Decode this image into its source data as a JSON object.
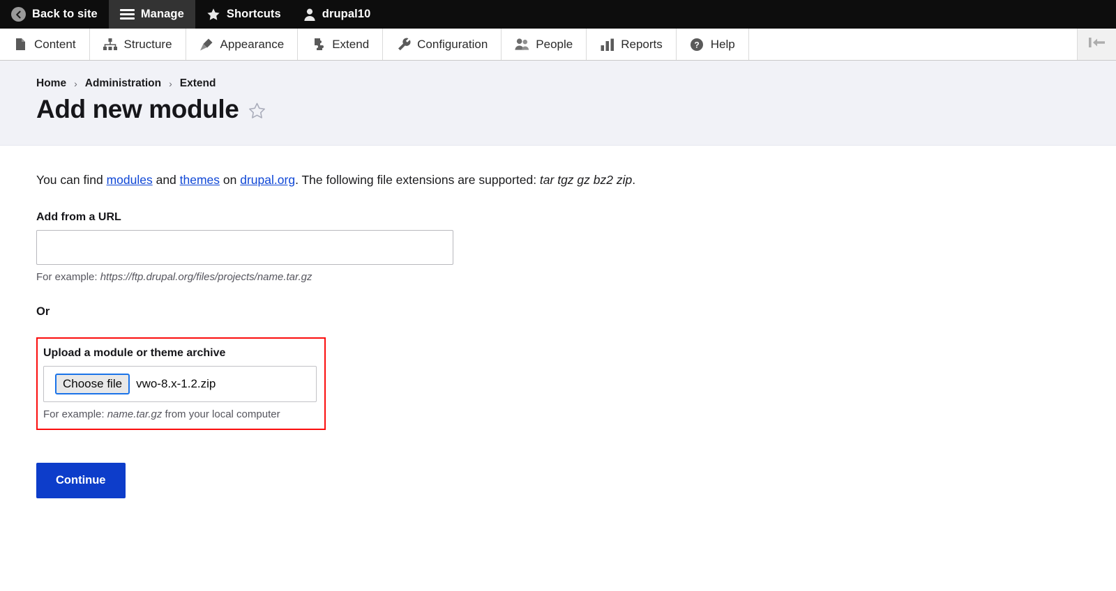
{
  "toolbar_top": {
    "items": [
      {
        "label": "Back to site",
        "icon": "back-circle-icon",
        "active": false
      },
      {
        "label": "Manage",
        "icon": "hamburger-icon",
        "active": true
      },
      {
        "label": "Shortcuts",
        "icon": "star-icon",
        "active": false
      },
      {
        "label": "drupal10",
        "icon": "user-icon",
        "active": false
      }
    ]
  },
  "admin_menu": {
    "items": [
      {
        "label": "Content",
        "icon": "document-icon"
      },
      {
        "label": "Structure",
        "icon": "sitemap-icon"
      },
      {
        "label": "Appearance",
        "icon": "paintbrush-icon"
      },
      {
        "label": "Extend",
        "icon": "puzzle-piece-icon"
      },
      {
        "label": "Configuration",
        "icon": "wrench-icon"
      },
      {
        "label": "People",
        "icon": "people-icon"
      },
      {
        "label": "Reports",
        "icon": "bar-chart-icon"
      },
      {
        "label": "Help",
        "icon": "question-mark-icon"
      }
    ],
    "orientation_toggle_icon": "toolbar-orientation-icon"
  },
  "header": {
    "breadcrumb": [
      "Home",
      "Administration",
      "Extend"
    ],
    "breadcrumb_separator": "›",
    "title": "Add new module",
    "bookmark_icon": "star-outline-icon"
  },
  "main": {
    "intro": {
      "part1": "You can find ",
      "link_modules": "modules",
      "part2": " and ",
      "link_themes": "themes",
      "part3": " on ",
      "link_drupal": "drupal.org",
      "part4": ". The following file extensions are supported: ",
      "extensions": "tar tgz gz bz2 zip",
      "part5": "."
    },
    "url_field": {
      "label": "Add from a URL",
      "value": "",
      "placeholder": "",
      "description_prefix": "For example: ",
      "description_example": "https://ftp.drupal.org/files/projects/name.tar.gz"
    },
    "or_label": "Or",
    "upload_field": {
      "label": "Upload a module or theme archive",
      "choose_file_label": "Choose file",
      "file_name": "vwo-8.x-1.2.zip",
      "description_prefix": "For example: ",
      "description_example": "name.tar.gz",
      "description_suffix": " from your local computer",
      "highlight_color": "#fb0d0d"
    },
    "submit_label": "Continue"
  },
  "colors": {
    "toolbar_bg": "#0d0d0d",
    "toolbar_active_bg": "#333333",
    "header_band": "#f1f2f7",
    "link": "#0f47d6",
    "primary_button": "#0d3dca",
    "highlight": "#fb0d0d"
  }
}
